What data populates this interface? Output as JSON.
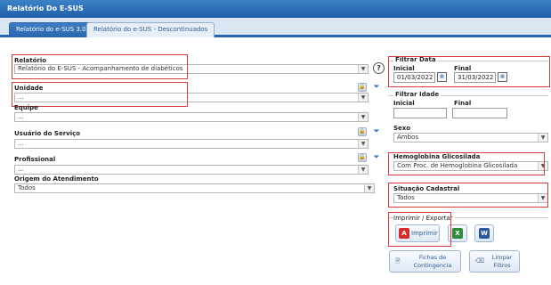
{
  "window": {
    "title": "Relatório Do E-SUS"
  },
  "tabs": [
    {
      "label": "Relatório do e-SUS 3.0",
      "active": true
    },
    {
      "label": "Relatório do e-SUS - Descontinuados",
      "active": false
    }
  ],
  "form": {
    "relatorio": {
      "label": "Relatório",
      "value": "Relatório do E-SUS - Acompanhamento de diabéticos"
    },
    "unidade": {
      "label": "Unidade",
      "value": "..."
    },
    "equipe": {
      "label": "Equipe",
      "value": "..."
    },
    "usuario_servico": {
      "label": "Usuário do Serviço",
      "value": "..."
    },
    "profissional": {
      "label": "Profissional",
      "value": "..."
    },
    "origem_atendimento": {
      "label": "Origem do Atendimento",
      "value": "Todos"
    }
  },
  "filtrar_data": {
    "label": "Filtrar Data",
    "inicial_label": "Inicial",
    "inicial_value": "01/03/2022",
    "final_label": "Final",
    "final_value": "31/03/2022"
  },
  "filtrar_idade": {
    "label": "Filtrar Idade",
    "inicial_label": "Inicial",
    "inicial_value": "",
    "final_label": "Final",
    "final_value": ""
  },
  "sexo": {
    "label": "Sexo",
    "value": "Ambos"
  },
  "hemoglobina": {
    "label": "Hemoglobina Glicosilada",
    "value": "Com Proc. de Hemoglobina Glicosilada"
  },
  "situacao_cadastral": {
    "label": "Situação Cadastral",
    "value": "Todos"
  },
  "imprimir_exportar": {
    "label": "Imprimir / Exportar",
    "imprimir_label": "Imprimir"
  },
  "bottom_buttons": {
    "fichas_line1": "Fichas de",
    "fichas_line2": "Contingencia",
    "limpar_line1": "Limpar",
    "limpar_line2": "Filtros"
  },
  "colors": {
    "accent": "#2a66ae",
    "highlight": "#d93a3a",
    "pdf": "#d42b2b",
    "excel": "#2e8b3a",
    "word": "#2b579a"
  }
}
